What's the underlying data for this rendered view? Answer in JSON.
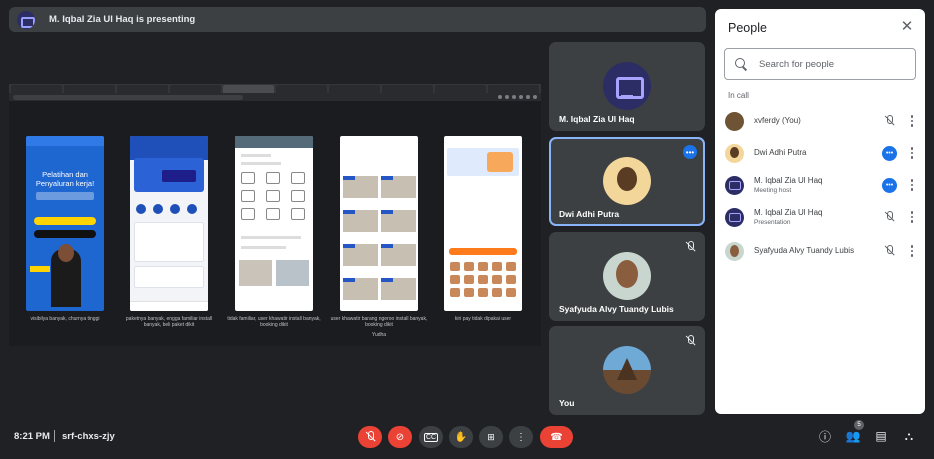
{
  "banner": {
    "text": "M. Iqbal Zia Ul Haq is presenting"
  },
  "screen": {
    "captions": [
      "visibilya banyak, churnya tinggi",
      "paketnya banyak, engga familiar install banyak, beli paket dikit",
      "tidak familiar, user khawatir install banyak, booking dikit",
      "user khawatir barang ngeroo install banyak, booking dikit",
      "kiri pay tidak dipakai user"
    ],
    "extra_caption": "Yudha",
    "phone1": {
      "headline": "Pelatihan dan Penyaluran kerja!"
    }
  },
  "tiles": [
    {
      "name": "M. Iqbal Zia Ul Haq"
    },
    {
      "name": "Dwi Adhi Putra"
    },
    {
      "name": "Syafyuda Alvy Tuandy Lubis"
    },
    {
      "name": "You"
    }
  ],
  "panel": {
    "title": "People",
    "search_placeholder": "Search for people",
    "section": "In call",
    "people": [
      {
        "name": "xvferdy (You)",
        "sub": ""
      },
      {
        "name": "Dwi Adhi Putra",
        "sub": ""
      },
      {
        "name": "M. Iqbal Zia Ul Haq",
        "sub": "Meeting host"
      },
      {
        "name": "M. Iqbal Zia Ul Haq",
        "sub": "Presentation"
      },
      {
        "name": "Syafyuda Alvy Tuandy Lubis",
        "sub": ""
      }
    ]
  },
  "bottom": {
    "time": "8:21 PM",
    "meeting_code": "srf-chxs-zjy",
    "people_count": "5"
  }
}
